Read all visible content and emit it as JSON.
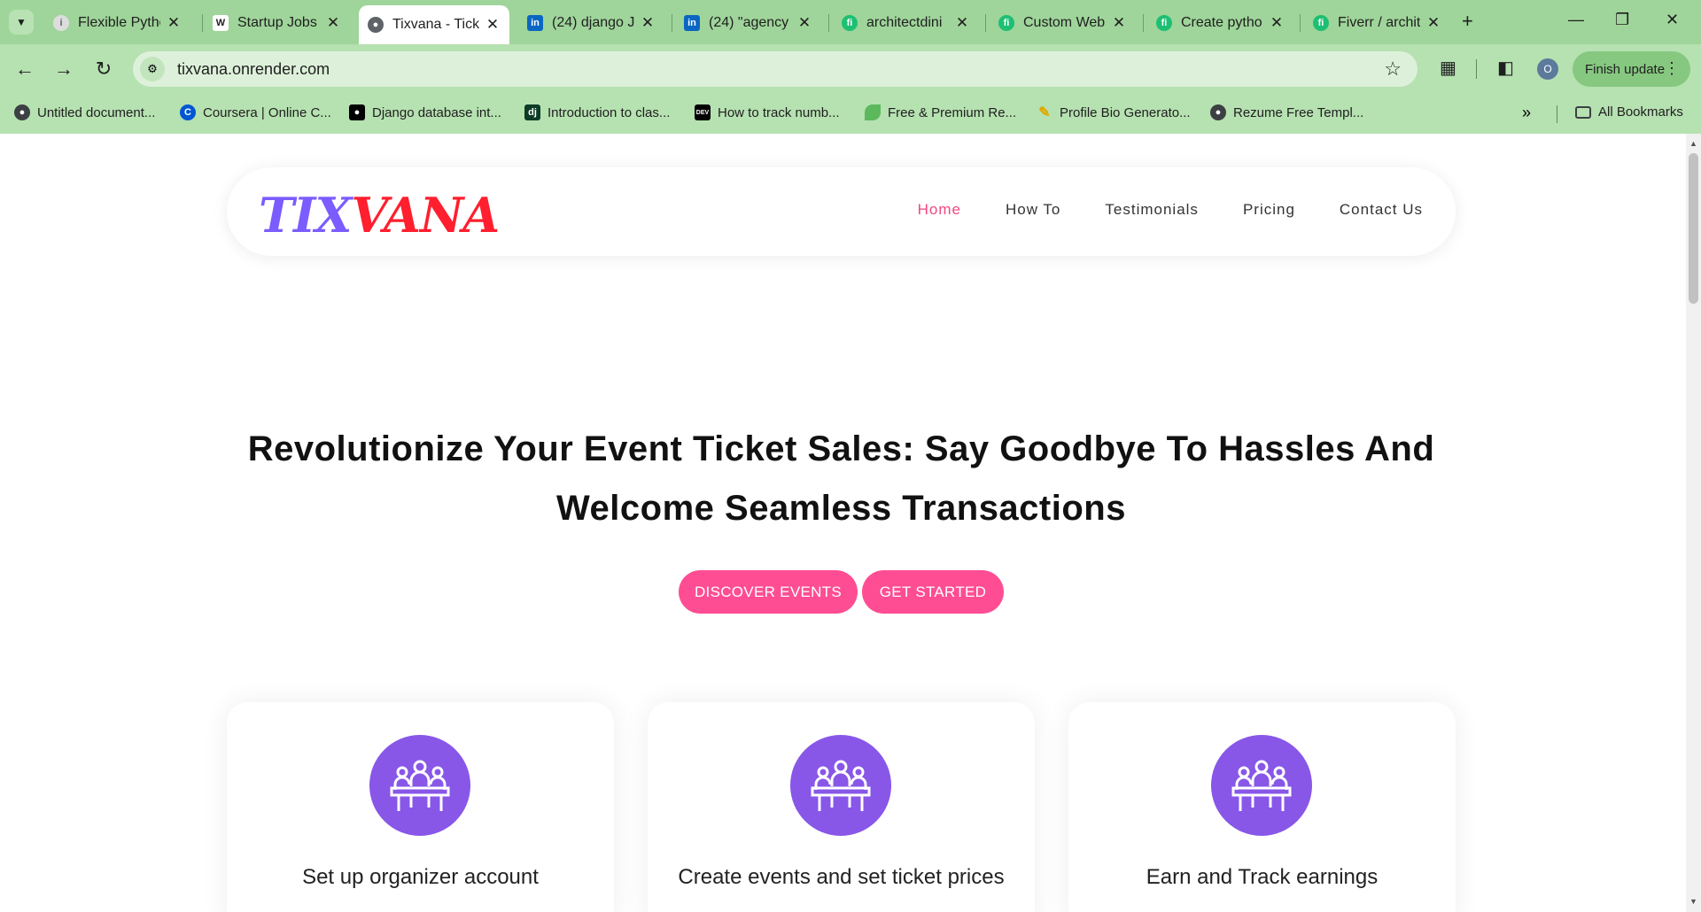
{
  "browser": {
    "tabs": [
      {
        "title": "Flexible Pytho",
        "favicon": "info-icon",
        "favicon_color": "#5f6368",
        "active": false
      },
      {
        "title": "Startup Jobs |",
        "favicon": "w-icon",
        "favicon_color": "#222222",
        "active": false
      },
      {
        "title": "Tixvana - Tick",
        "favicon": "globe-icon",
        "favicon_color": "#5f6368",
        "active": true
      },
      {
        "title": "(24) django J",
        "favicon": "linkedin-icon",
        "favicon_color": "#0a66c2",
        "active": false
      },
      {
        "title": "(24) \"agency",
        "favicon": "linkedin-icon",
        "favicon_color": "#0a66c2",
        "active": false
      },
      {
        "title": "architectdini",
        "favicon": "fiverr-icon",
        "favicon_color": "#1dbf73",
        "active": false
      },
      {
        "title": "Custom Web",
        "favicon": "fiverr-icon",
        "favicon_color": "#1dbf73",
        "active": false
      },
      {
        "title": "Create pytho",
        "favicon": "fiverr-icon",
        "favicon_color": "#1dbf73",
        "active": false
      },
      {
        "title": "Fiverr / archit",
        "favicon": "fiverr-icon",
        "favicon_color": "#1dbf73",
        "active": false
      }
    ],
    "url": "tixvana.onrender.com",
    "profile_initial": "O",
    "finish_update_label": "Finish update",
    "bookmarks": [
      {
        "label": "Untitled document...",
        "icon": "globe-icon"
      },
      {
        "label": "Coursera | Online C...",
        "icon": "coursera-icon"
      },
      {
        "label": "Django database int...",
        "icon": "medium-icon"
      },
      {
        "label": "Introduction to clas...",
        "icon": "django-icon"
      },
      {
        "label": "How to track numb...",
        "icon": "dev-icon"
      },
      {
        "label": "Free & Premium Re...",
        "icon": "leaf-icon"
      },
      {
        "label": "Profile Bio Generato...",
        "icon": "pencil-icon"
      },
      {
        "label": "Rezume Free Templ...",
        "icon": "globe-icon"
      }
    ],
    "all_bookmarks_label": "All Bookmarks"
  },
  "site": {
    "logo_part1": "TIX",
    "logo_part2": "VANA",
    "nav": [
      "Home",
      "How To",
      "Testimonials",
      "Pricing",
      "Contact Us"
    ],
    "hero_title": "Revolutionize Your Event Ticket Sales: Say Goodbye To Hassles And Welcome Seamless Transactions",
    "cta_discover": "DISCOVER EVENTS",
    "cta_start": "GET STARTED",
    "cards": [
      {
        "text": "Set up organizer account",
        "icon": "meeting-icon"
      },
      {
        "text": "Create events and set ticket prices",
        "icon": "meeting-icon"
      },
      {
        "text": "Earn and Track earnings",
        "icon": "meeting-icon"
      }
    ]
  },
  "colors": {
    "chrome_bg": "#9fd59a",
    "accent_pink": "#ff4d93",
    "nav_active": "#f0477f",
    "logo_purple": "#7b5cff",
    "logo_red": "#ff1f2e",
    "card_icon_bg": "#8857e8"
  }
}
